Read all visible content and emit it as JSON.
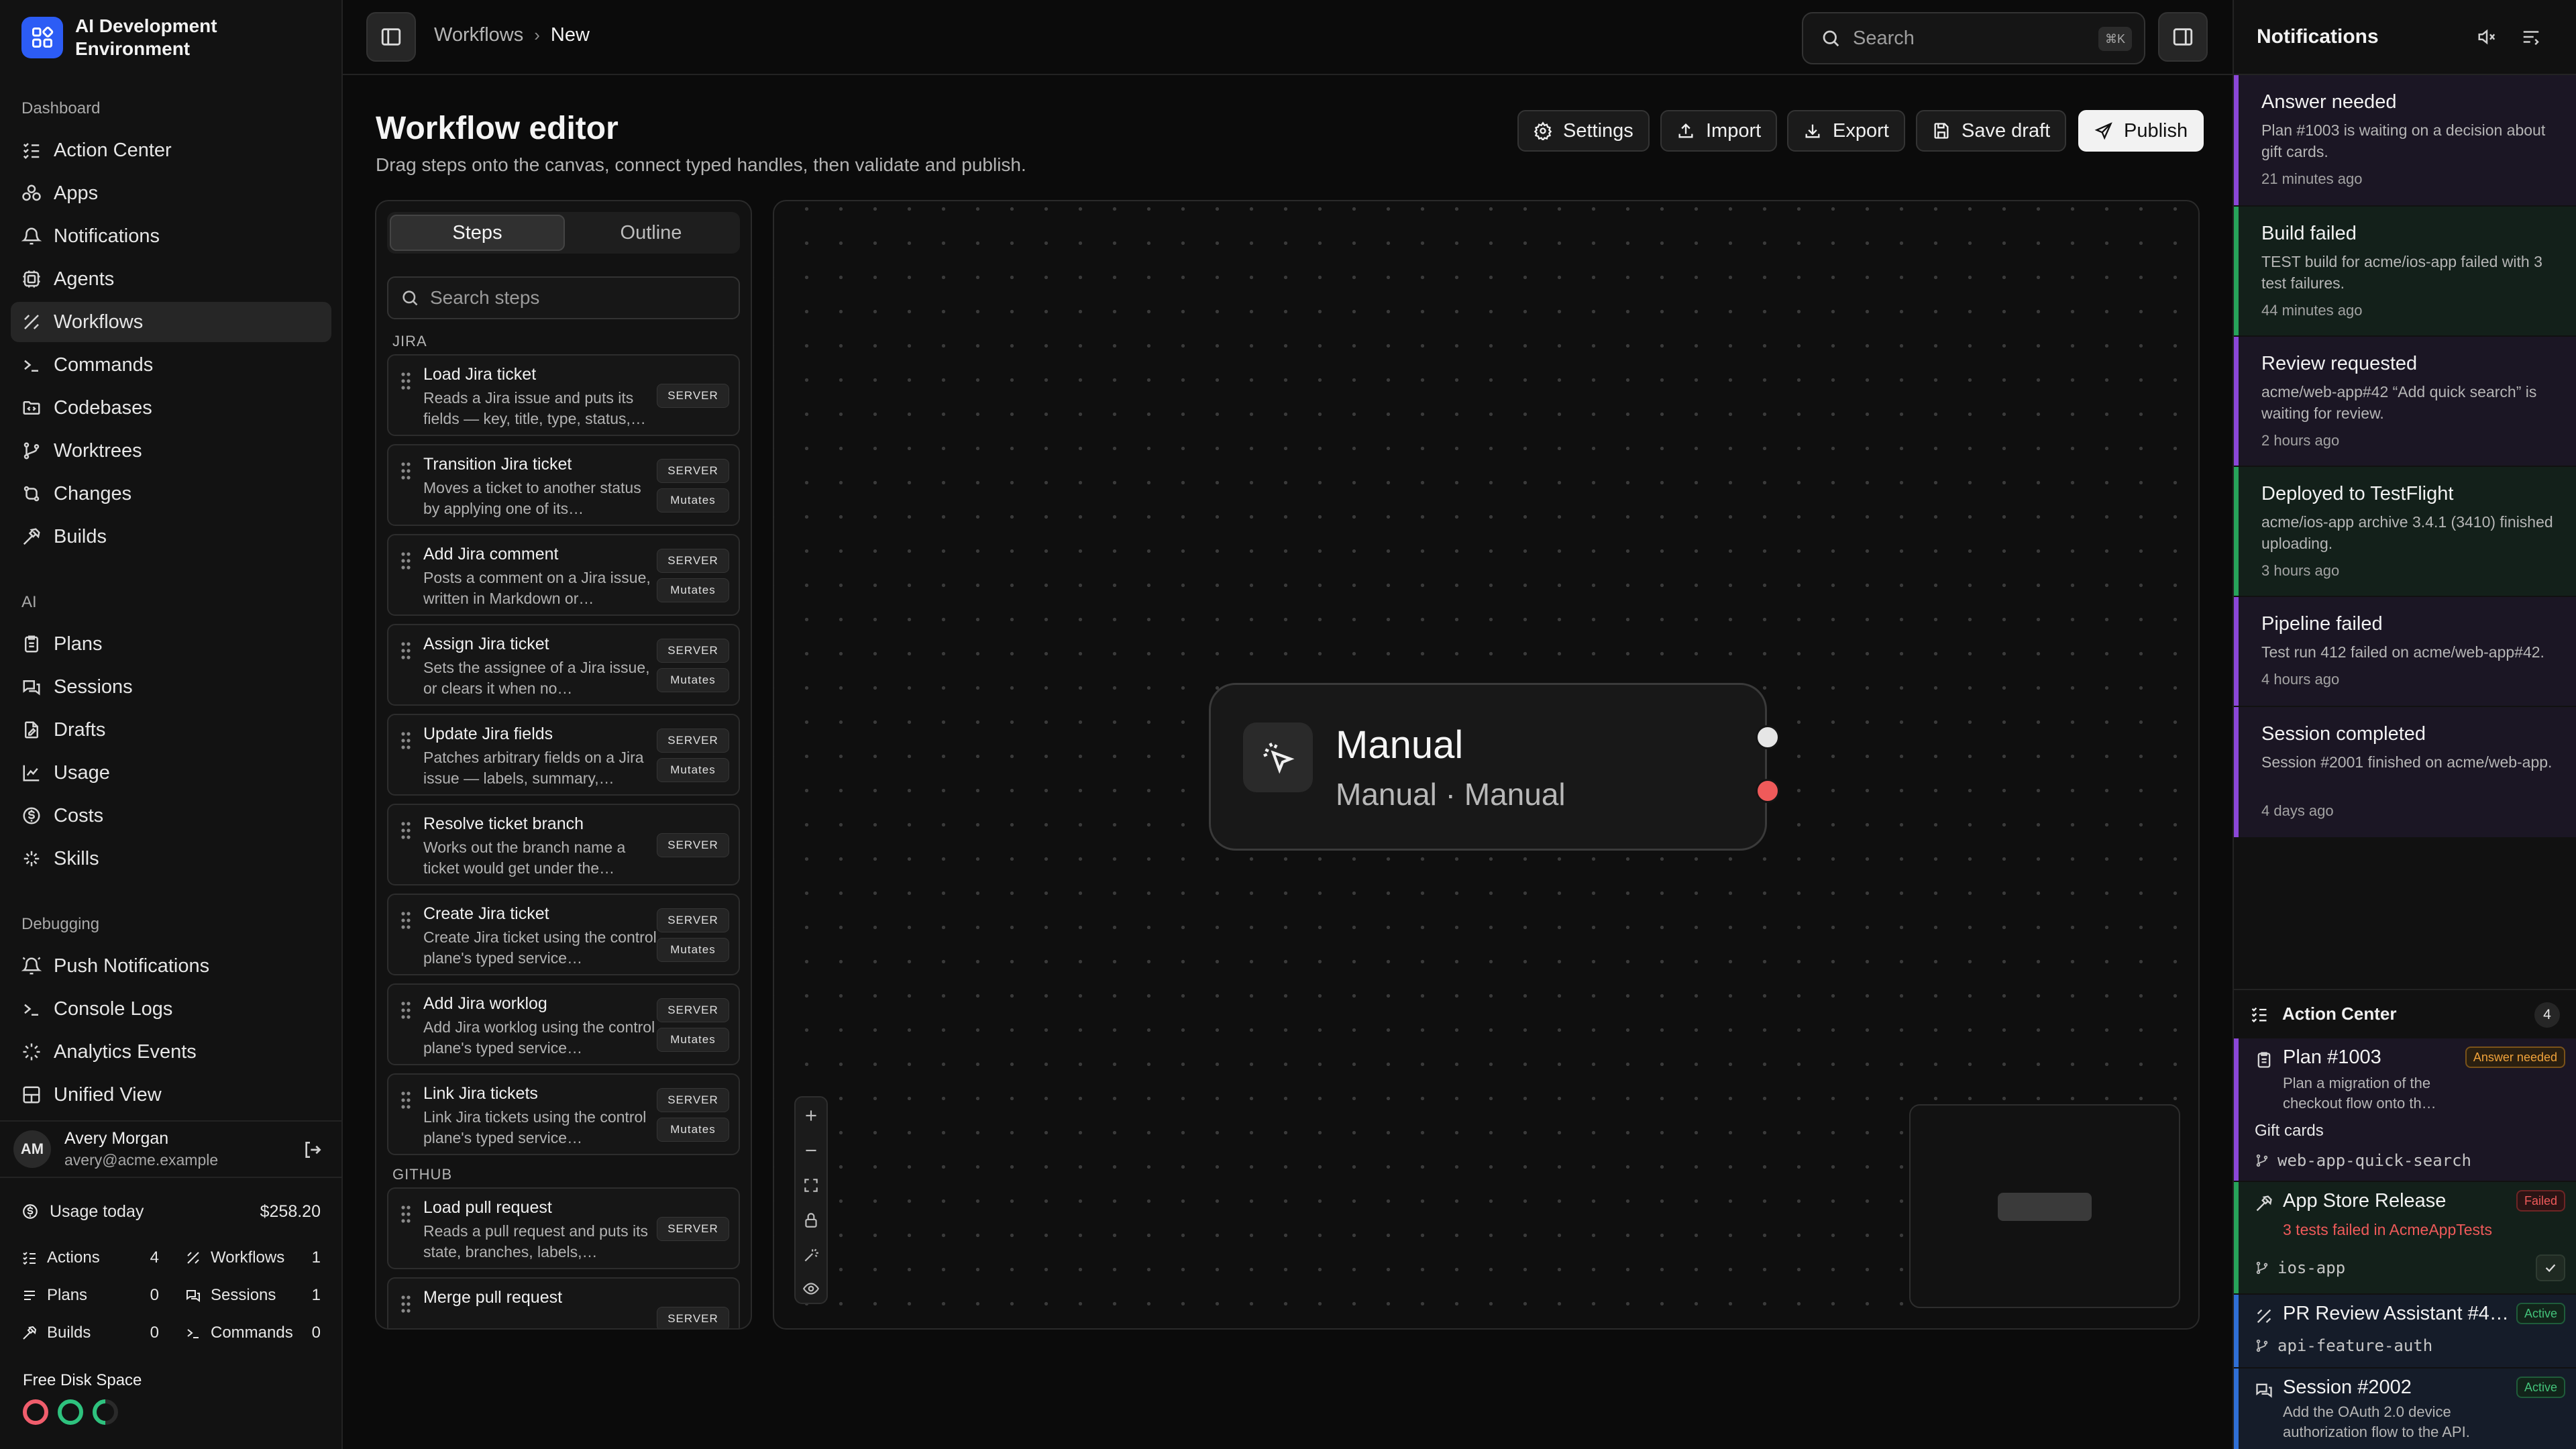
{
  "app": {
    "title": "AI Development Environment"
  },
  "sidebar": {
    "sections": [
      {
        "label": "Dashboard",
        "items": [
          {
            "label": "Action Center",
            "icon": "list-check-icon"
          },
          {
            "label": "Apps",
            "icon": "apps-icon"
          },
          {
            "label": "Notifications",
            "icon": "bell-icon"
          },
          {
            "label": "Agents",
            "icon": "bot-icon"
          },
          {
            "label": "Workflows",
            "icon": "workflow-icon",
            "active": true
          },
          {
            "label": "Commands",
            "icon": "terminal-icon"
          },
          {
            "label": "Codebases",
            "icon": "folder-code-icon"
          },
          {
            "label": "Worktrees",
            "icon": "git-branch-icon"
          },
          {
            "label": "Changes",
            "icon": "git-compare-icon"
          },
          {
            "label": "Builds",
            "icon": "hammer-icon"
          }
        ]
      },
      {
        "label": "AI",
        "items": [
          {
            "label": "Plans",
            "icon": "clipboard-icon"
          },
          {
            "label": "Sessions",
            "icon": "chat-icon"
          },
          {
            "label": "Drafts",
            "icon": "file-edit-icon"
          },
          {
            "label": "Usage",
            "icon": "chart-line-icon"
          },
          {
            "label": "Costs",
            "icon": "dollar-icon"
          },
          {
            "label": "Skills",
            "icon": "sparkles-icon"
          }
        ]
      },
      {
        "label": "Debugging",
        "items": [
          {
            "label": "Push Notifications",
            "icon": "bell-ring-icon"
          },
          {
            "label": "Console Logs",
            "icon": "terminal-icon"
          },
          {
            "label": "Analytics Events",
            "icon": "activity-icon"
          },
          {
            "label": "Unified View",
            "icon": "layout-icon"
          }
        ]
      }
    ],
    "user": {
      "initials": "AM",
      "name": "Avery Morgan",
      "email": "avery@acme.example"
    },
    "usage": {
      "label": "Usage today",
      "value": "$258.20"
    },
    "stats": [
      {
        "label": "Actions",
        "value": "4",
        "icon": "list-check-icon"
      },
      {
        "label": "Workflows",
        "value": "1",
        "icon": "workflow-icon"
      },
      {
        "label": "Plans",
        "value": "0",
        "icon": "list-icon"
      },
      {
        "label": "Sessions",
        "value": "1",
        "icon": "chat-icon"
      },
      {
        "label": "Builds",
        "value": "0",
        "icon": "hammer-icon"
      },
      {
        "label": "Commands",
        "value": "0",
        "icon": "terminal-icon"
      }
    ],
    "disk": {
      "label": "Free Disk Space",
      "colors": [
        "#f05d6c",
        "#2ec27e",
        "#2ec27e"
      ]
    }
  },
  "topbar": {
    "breadcrumb": [
      "Workflows",
      "New"
    ],
    "search_placeholder": "Search",
    "search_shortcut": "⌘K"
  },
  "editor": {
    "title": "Workflow editor",
    "subtitle": "Drag steps onto the canvas, connect typed handles, then validate and publish.",
    "buttons": {
      "settings": "Settings",
      "import": "Import",
      "export": "Export",
      "save_draft": "Save draft",
      "publish": "Publish"
    }
  },
  "steps_panel": {
    "tabs": [
      "Steps",
      "Outline"
    ],
    "active_tab": "Steps",
    "search_placeholder": "Search steps",
    "groups": [
      {
        "label": "JIRA",
        "steps": [
          {
            "title": "Load Jira ticket",
            "desc": "Reads a Jira issue and puts its fields — key, title, type, status,…",
            "tags": [
              "SERVER"
            ]
          },
          {
            "title": "Transition Jira ticket",
            "desc": "Moves a ticket to another status by applying one of its…",
            "tags": [
              "SERVER",
              "Mutates"
            ]
          },
          {
            "title": "Add Jira comment",
            "desc": "Posts a comment on a Jira issue, written in Markdown or…",
            "tags": [
              "SERVER",
              "Mutates"
            ]
          },
          {
            "title": "Assign Jira ticket",
            "desc": "Sets the assignee of a Jira issue, or clears it when no…",
            "tags": [
              "SERVER",
              "Mutates"
            ]
          },
          {
            "title": "Update Jira fields",
            "desc": "Patches arbitrary fields on a Jira issue — labels, summary,…",
            "tags": [
              "SERVER",
              "Mutates"
            ]
          },
          {
            "title": "Resolve ticket branch",
            "desc": "Works out the branch name a ticket would get under the…",
            "tags": [
              "SERVER"
            ]
          },
          {
            "title": "Create Jira ticket",
            "desc": "Create Jira ticket using the control plane's typed service…",
            "tags": [
              "SERVER",
              "Mutates"
            ]
          },
          {
            "title": "Add Jira worklog",
            "desc": "Add Jira worklog using the control plane's typed service…",
            "tags": [
              "SERVER",
              "Mutates"
            ]
          },
          {
            "title": "Link Jira tickets",
            "desc": "Link Jira tickets using the control plane's typed service…",
            "tags": [
              "SERVER",
              "Mutates"
            ]
          }
        ]
      },
      {
        "label": "GITHUB",
        "steps": [
          {
            "title": "Load pull request",
            "desc": "Reads a pull request and puts its state, branches, labels,…",
            "tags": [
              "SERVER"
            ]
          },
          {
            "title": "Merge pull request",
            "desc": "",
            "tags": [
              "SERVER"
            ]
          }
        ]
      }
    ]
  },
  "canvas": {
    "node": {
      "title": "Manual",
      "subtitle": "Manual · Manual",
      "icon": "pointer-click-icon"
    },
    "handle_colors": [
      "#e6e6e6",
      "#ef5a5a"
    ]
  },
  "notifications": {
    "title": "Notifications",
    "items": [
      {
        "title": "Answer needed",
        "body": "Plan #1003 is waiting on a decision about gift cards.",
        "time": "21 minutes ago",
        "color": "#8b47d8",
        "bg": "#1b1624"
      },
      {
        "title": "Build failed",
        "body": "TEST build for acme/ios-app failed with 3 test failures.",
        "time": "44 minutes ago",
        "color": "#27a35a",
        "bg": "#13201a"
      },
      {
        "title": "Review requested",
        "body": "acme/web-app#42 “Add quick search” is waiting for review.",
        "time": "2 hours ago",
        "color": "#8b47d8",
        "bg": "#1b1624"
      },
      {
        "title": "Deployed to TestFlight",
        "body": "acme/ios-app archive 3.4.1 (3410) finished uploading.",
        "time": "3 hours ago",
        "color": "#27a35a",
        "bg": "#13201a"
      },
      {
        "title": "Pipeline failed",
        "body": "Test run 412 failed on acme/web-app#42.",
        "time": "4 hours ago",
        "color": "#8b47d8",
        "bg": "#1b1624"
      },
      {
        "title": "Session completed",
        "body": "Session #2001 finished on acme/web-app.",
        "time": "4 days ago",
        "color": "#8b47d8",
        "bg": "#1b1624"
      }
    ]
  },
  "action_center": {
    "title": "Action Center",
    "count": "4",
    "items": [
      {
        "title": "Plan #1003",
        "body": "Plan a migration of the checkout flow onto th…",
        "extra": "Gift cards",
        "branch": "web-app-quick-search",
        "badge": "Answer needed",
        "color": "#8b47d8",
        "bg": "#1b1624"
      },
      {
        "title": "App Store Release",
        "body": "3 tests failed in AcmeAppTests",
        "branch": "ios-app",
        "badge": "Failed",
        "color": "#27a35a",
        "bg": "#13201a"
      },
      {
        "title": "PR Review Assistant #4…",
        "branch": "api-feature-auth",
        "badge": "Active",
        "color": "#2f6fd6",
        "bg": "#151c29"
      },
      {
        "title": "Session #2002",
        "body": "Add the OAuth 2.0 device authorization flow to the API.",
        "badge": "Active",
        "color": "#2f6fd6",
        "bg": "#151c29"
      }
    ]
  }
}
